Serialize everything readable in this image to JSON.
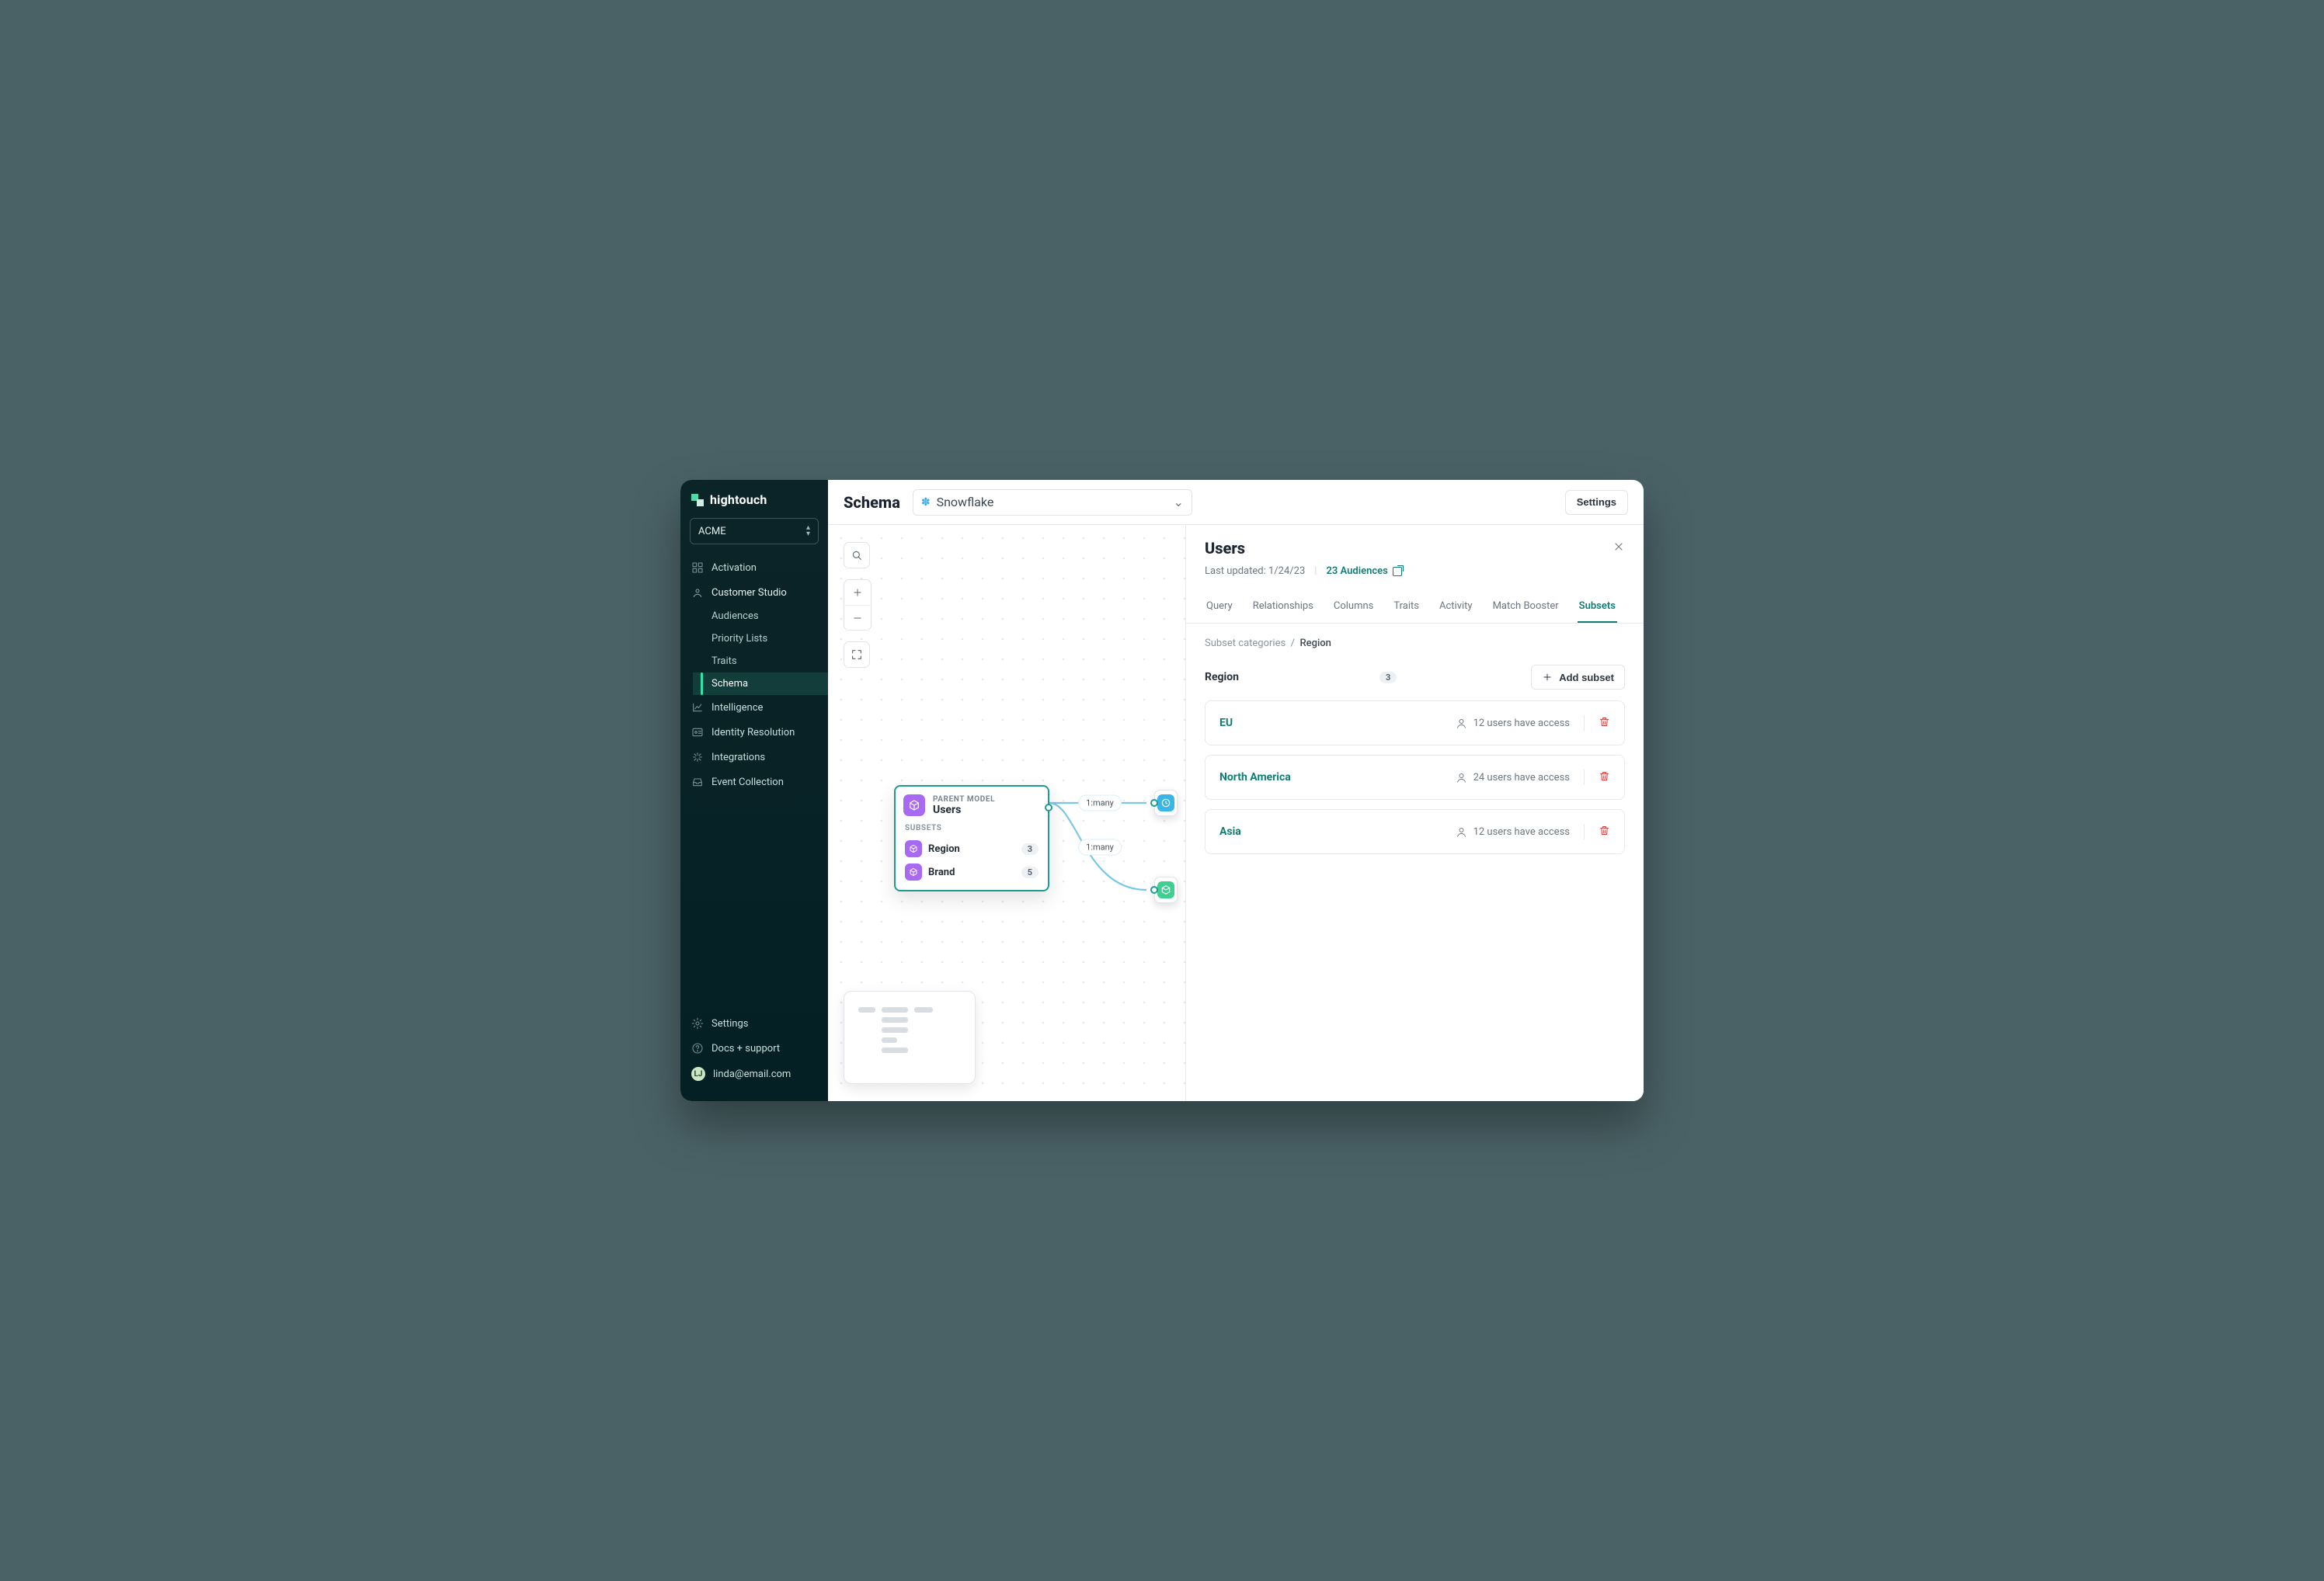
{
  "brand": {
    "name": "hightouch"
  },
  "workspace": {
    "name": "ACME"
  },
  "sidebar": {
    "items": [
      {
        "label": "Activation"
      },
      {
        "label": "Customer Studio"
      },
      {
        "label": "Intelligence"
      },
      {
        "label": "Identity Resolution"
      },
      {
        "label": "Integrations"
      },
      {
        "label": "Event Collection"
      }
    ],
    "customer_studio_sub": [
      {
        "label": "Audiences"
      },
      {
        "label": "Priority Lists"
      },
      {
        "label": "Traits"
      },
      {
        "label": "Schema"
      }
    ],
    "bottom": {
      "settings": "Settings",
      "docs": "Docs + support",
      "user_email": "linda@email.com",
      "user_initials": "LJ"
    }
  },
  "topbar": {
    "title": "Schema",
    "source": "Snowflake",
    "settings_btn": "Settings"
  },
  "model_card": {
    "caption": "PARENT MODEL",
    "name": "Users",
    "subsets_label": "SUBSETS",
    "subsets": [
      {
        "name": "Region",
        "count": "3"
      },
      {
        "name": "Brand",
        "count": "5"
      }
    ]
  },
  "edges": {
    "label_top": "1:many",
    "label_bottom": "1:many"
  },
  "panel": {
    "title": "Users",
    "last_updated_label": "Last updated:",
    "last_updated_value": "1/24/23",
    "audiences_link": "23 Audiences",
    "tabs": [
      "Query",
      "Relationships",
      "Columns",
      "Traits",
      "Activity",
      "Match Booster",
      "Subsets"
    ],
    "active_tab": "Subsets",
    "breadcrumb_root": "Subset categories",
    "breadcrumb_current": "Region",
    "region": {
      "name": "Region",
      "count": "3"
    },
    "add_subset_label": "Add subset",
    "subsets": [
      {
        "name": "EU",
        "access": "12 users have access"
      },
      {
        "name": "North America",
        "access": "24 users have access"
      },
      {
        "name": "Asia",
        "access": "12 users have access"
      }
    ]
  }
}
